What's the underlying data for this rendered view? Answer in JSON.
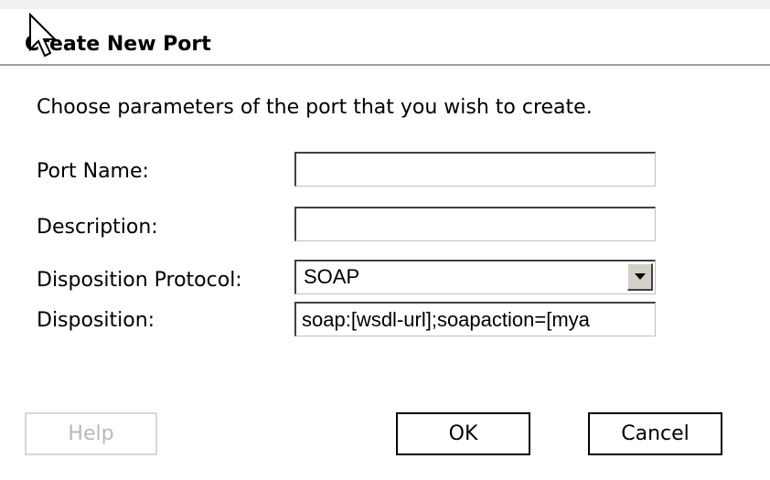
{
  "dialog": {
    "title": "Create New Port",
    "instruction": "Choose parameters of the port that you wish to create."
  },
  "form": {
    "port_name_label": "Port Name:",
    "port_name_value": "",
    "description_label": "Description:",
    "description_value": "",
    "disposition_protocol_label": "Disposition Protocol:",
    "disposition_protocol_value": "SOAP",
    "disposition_label": "Disposition:",
    "disposition_value": "soap:[wsdl-url];soapaction=[mya"
  },
  "buttons": {
    "help": "Help",
    "ok": "OK",
    "cancel": "Cancel"
  },
  "icons": {
    "cursor": "mouse-pointer-icon",
    "dropdown": "chevron-down-icon"
  },
  "colors": {
    "title_rule": "#a0a0a0",
    "disabled_text": "#b8b8b8"
  }
}
